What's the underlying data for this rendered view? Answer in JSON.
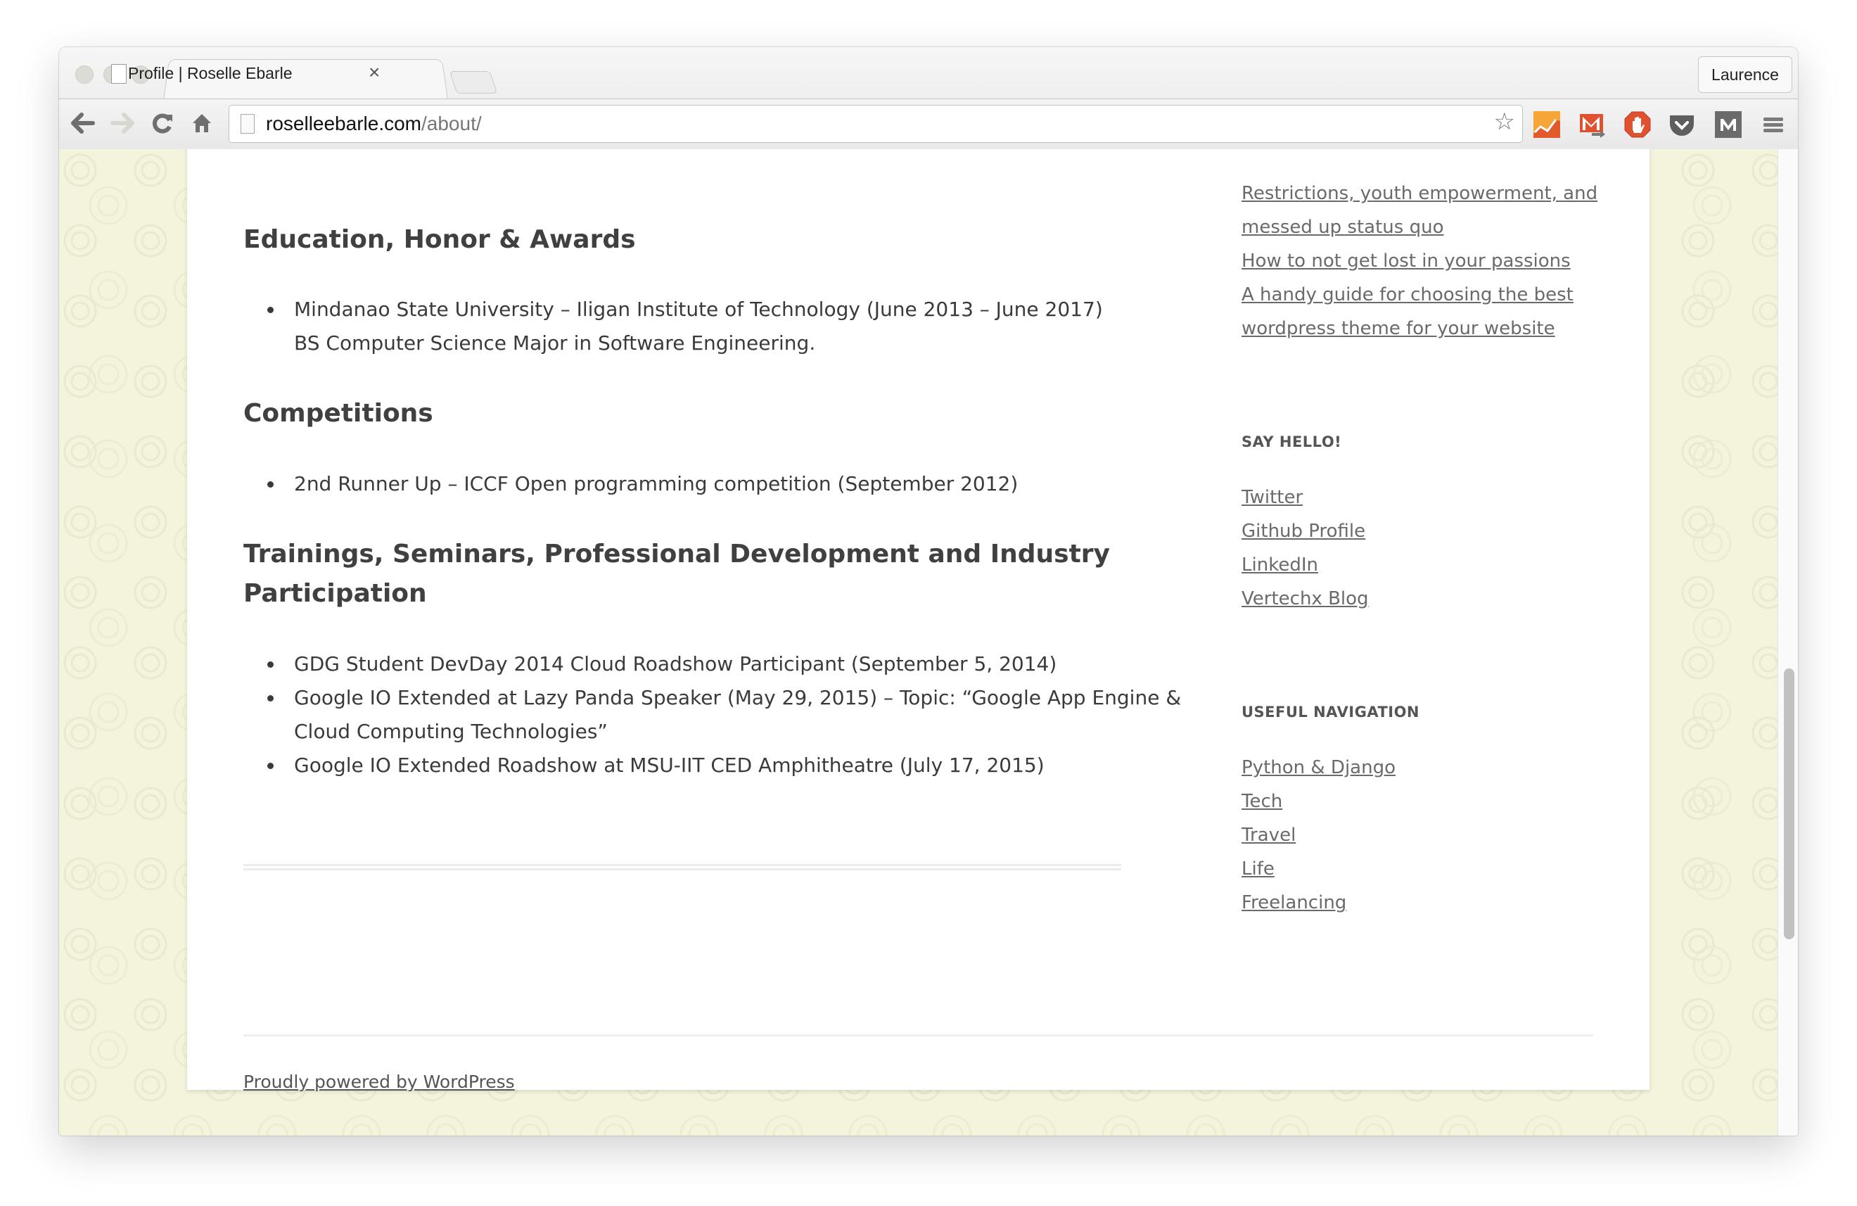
{
  "browser": {
    "tab_title": "Profile | Roselle Ebarle",
    "tab_close": "×",
    "profile_name": "Laurence",
    "url_domain": "roselleebarle.com",
    "url_path": "/about/",
    "star": "☆",
    "extensions": [
      "google-analytics-icon",
      "gmail-checker-icon",
      "adblock-icon",
      "pocket-icon",
      "medium-icon",
      "menu-icon"
    ]
  },
  "main": {
    "sections": [
      {
        "heading": "Education, Honor & Awards",
        "items": [
          {
            "line1": "Mindanao State University – Iligan Institute of Technology (June 2013 – June 2017)",
            "line2": "BS Computer Science Major in Software Engineering."
          }
        ]
      },
      {
        "heading": "Competitions",
        "items": [
          {
            "line1": "2nd Runner Up – ICCF Open programming competition (September 2012)"
          }
        ]
      },
      {
        "heading_line1": "Trainings, Seminars, Professional Development and Industry",
        "heading_line2": "Participation",
        "items": [
          {
            "line1": "GDG Student DevDay 2014 Cloud Roadshow Participant (September 5, 2014)"
          },
          {
            "line1": "Google IO Extended at Lazy Panda Speaker (May 29, 2015) – Topic: “Google App Engine &",
            "line2": "Cloud Computing Technologies”"
          },
          {
            "line1": "Google IO Extended Roadshow at MSU-IIT CED Amphitheatre (July 17, 2015)"
          }
        ]
      }
    ]
  },
  "sidebar": {
    "recent_posts": [
      {
        "line1": "Restrictions, youth empowerment, and",
        "line2": "messed up status quo"
      },
      {
        "line1": "How to not get lost in your passions"
      },
      {
        "line1": "A handy guide for choosing the best",
        "line2": "wordpress theme for your website"
      }
    ],
    "say_hello": {
      "title": "SAY HELLO!",
      "links": [
        "Twitter",
        "Github Profile",
        "LinkedIn",
        "Vertechx Blog"
      ]
    },
    "useful_navigation": {
      "title": "USEFUL NAVIGATION",
      "links": [
        "Python & Django",
        "Tech",
        "Travel",
        "Life",
        "Freelancing"
      ]
    }
  },
  "footer": {
    "credit": "Proudly powered by WordPress"
  }
}
